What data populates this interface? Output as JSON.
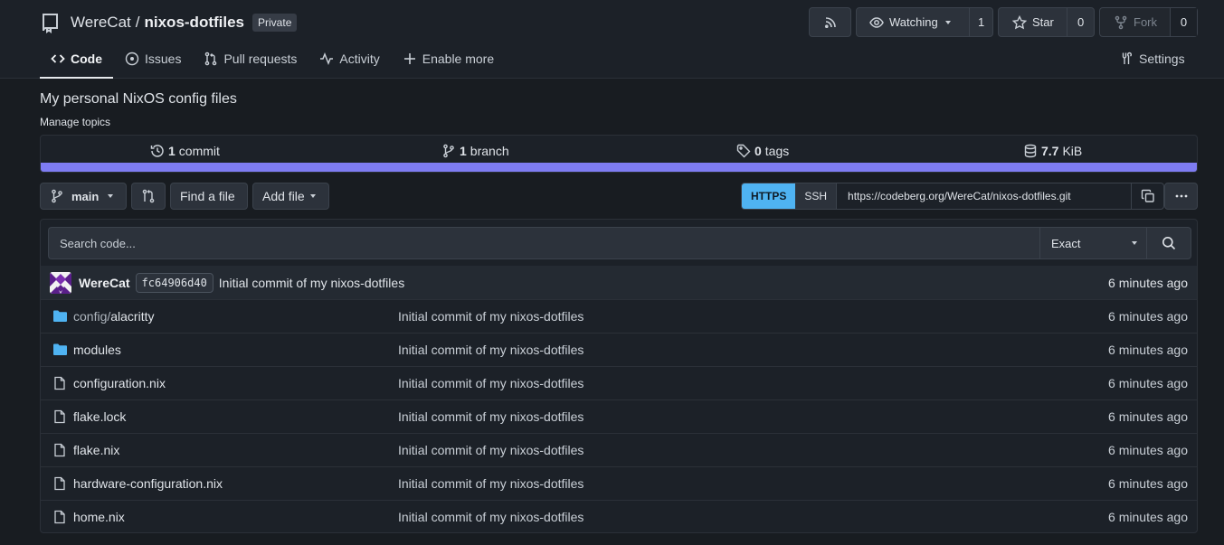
{
  "repo": {
    "owner": "WereCat",
    "separator": "/",
    "name": "nixos-dotfiles",
    "visibility": "Private",
    "description": "My personal NixOS config files",
    "manage_topics": "Manage topics"
  },
  "actions": {
    "watching_label": "Watching",
    "watching_count": "1",
    "star_label": "Star",
    "star_count": "0",
    "fork_label": "Fork",
    "fork_count": "0"
  },
  "tabs": [
    {
      "label": "Code",
      "icon": "code-icon",
      "active": true
    },
    {
      "label": "Issues",
      "icon": "issue-icon"
    },
    {
      "label": "Pull requests",
      "icon": "pull-request-icon"
    },
    {
      "label": "Activity",
      "icon": "pulse-icon"
    },
    {
      "label": "Enable more",
      "icon": "plus-icon"
    }
  ],
  "settings_label": "Settings",
  "stats": {
    "commits_count": "1",
    "commits_label": "commit",
    "branches_count": "1",
    "branches_label": "branch",
    "tags_count": "0",
    "tags_label": "tags",
    "size_value": "7.7",
    "size_unit": "KiB"
  },
  "language_bar_color": "#7e7cf2",
  "toolbar": {
    "branch": "main",
    "find_file": "Find a file",
    "add_file": "Add file"
  },
  "clone": {
    "https": "HTTPS",
    "ssh": "SSH",
    "url": "https://codeberg.org/WereCat/nixos-dotfiles.git"
  },
  "search": {
    "placeholder": "Search code...",
    "mode": "Exact"
  },
  "latest_commit": {
    "author": "WereCat",
    "sha": "fc64906d40",
    "message": "Initial commit of my nixos-dotfiles",
    "time": "6 minutes ago"
  },
  "files": [
    {
      "type": "dir",
      "prefix": "config/",
      "name": "alacritty",
      "message": "Initial commit of my nixos-dotfiles",
      "time": "6 minutes ago"
    },
    {
      "type": "dir",
      "prefix": "",
      "name": "modules",
      "message": "Initial commit of my nixos-dotfiles",
      "time": "6 minutes ago"
    },
    {
      "type": "file",
      "prefix": "",
      "name": "configuration.nix",
      "message": "Initial commit of my nixos-dotfiles",
      "time": "6 minutes ago"
    },
    {
      "type": "file",
      "prefix": "",
      "name": "flake.lock",
      "message": "Initial commit of my nixos-dotfiles",
      "time": "6 minutes ago"
    },
    {
      "type": "file",
      "prefix": "",
      "name": "flake.nix",
      "message": "Initial commit of my nixos-dotfiles",
      "time": "6 minutes ago"
    },
    {
      "type": "file",
      "prefix": "",
      "name": "hardware-configuration.nix",
      "message": "Initial commit of my nixos-dotfiles",
      "time": "6 minutes ago"
    },
    {
      "type": "file",
      "prefix": "",
      "name": "home.nix",
      "message": "Initial commit of my nixos-dotfiles",
      "time": "6 minutes ago"
    }
  ]
}
